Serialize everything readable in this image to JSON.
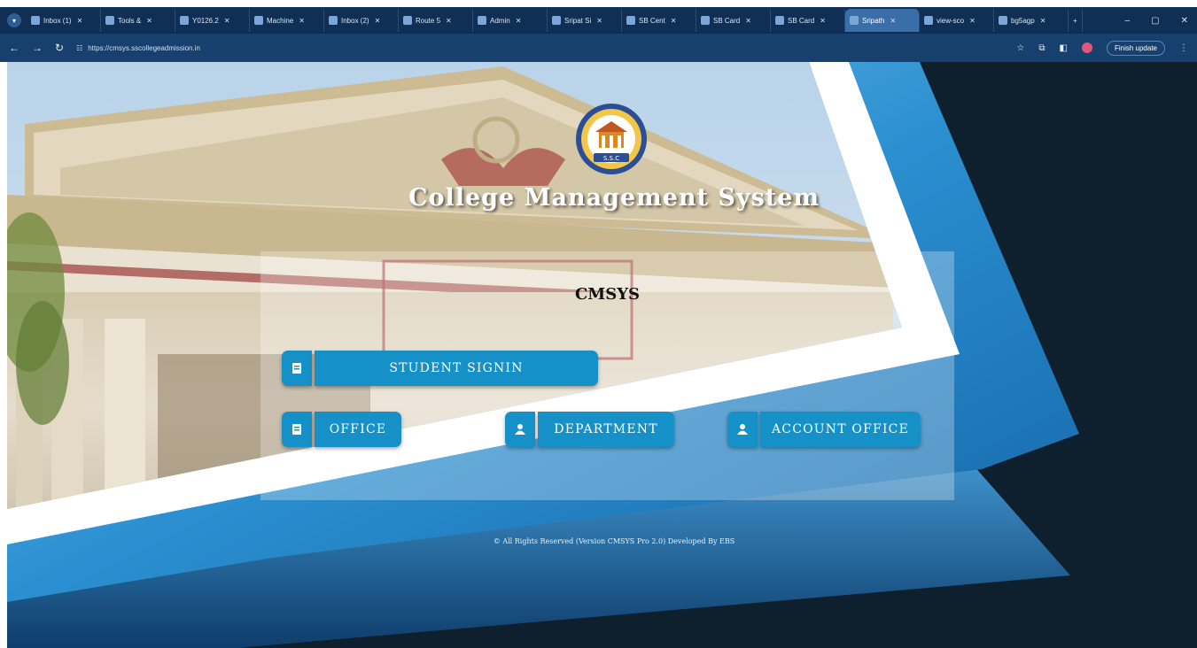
{
  "browser": {
    "tabs": [
      {
        "title": "Inbox (1)",
        "active": false
      },
      {
        "title": "Tools &",
        "active": false
      },
      {
        "title": "Y0126.2",
        "active": false
      },
      {
        "title": "Machine",
        "active": false
      },
      {
        "title": "Inbox (2)",
        "active": false
      },
      {
        "title": "Route 5",
        "active": false
      },
      {
        "title": "Admin",
        "active": false
      },
      {
        "title": "Sripat Si",
        "active": false
      },
      {
        "title": "SB Cent",
        "active": false
      },
      {
        "title": "SB Card",
        "active": false
      },
      {
        "title": "SB Card",
        "active": false
      },
      {
        "title": "Sripath",
        "active": true
      },
      {
        "title": "view-sco",
        "active": false
      },
      {
        "title": "bg5agp",
        "active": false
      }
    ],
    "new_tab": "+",
    "window_controls": [
      "–",
      "▢",
      "✕"
    ],
    "url": "https://cmsys.sscollegeadmission.in",
    "update_label": "Finish update",
    "colors": {
      "tabstrip": "#0f2f55",
      "toolbar": "#17406f"
    }
  },
  "page": {
    "logo_text": "S.S.C",
    "title": "College Management System",
    "brand": "CMSYS",
    "buttons": {
      "student_signin": "STUDENT SIGNIN",
      "office": "OFFICE",
      "department": "DEPARTMENT",
      "account_office": "ACCOUNT OFFICE"
    },
    "footer": "© All Rights Reserved (Version CMSYS Pro 2.0) Developed By EBS",
    "colors": {
      "button": "#1591c8",
      "background": "#0e1f2d",
      "accent_blue": "#1a78b8"
    }
  }
}
